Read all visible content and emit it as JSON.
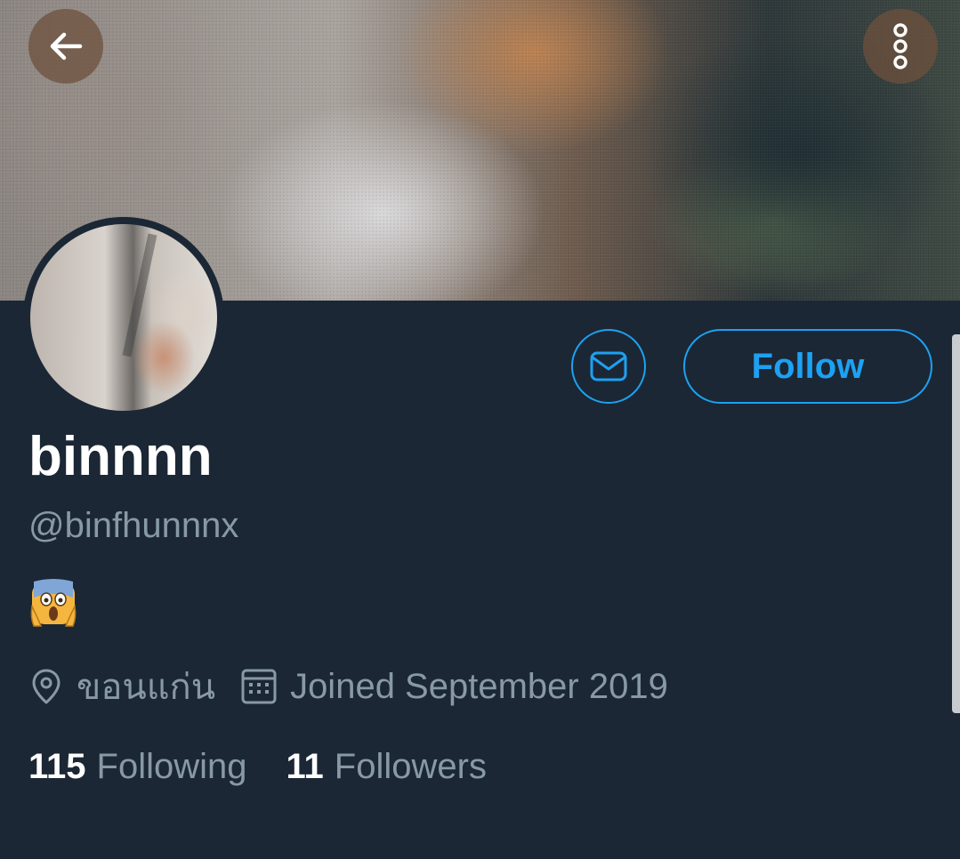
{
  "header": {
    "back_icon": "arrow-left-icon",
    "more_icon": "more-vertical-icon"
  },
  "profile": {
    "display_name": "binnnn",
    "handle": "@binfhunnnx",
    "bio_emoji": "face-screaming-in-fear",
    "location": "ขอนแก่น",
    "joined": "Joined September 2019",
    "following_count": "115",
    "following_label": "Following",
    "followers_count": "11",
    "followers_label": "Followers"
  },
  "actions": {
    "message_icon": "envelope-icon",
    "follow_label": "Follow"
  },
  "colors": {
    "background": "#1b2735",
    "accent": "#1da1f2",
    "secondary_text": "#8899a6",
    "primary_text": "#ffffff"
  }
}
